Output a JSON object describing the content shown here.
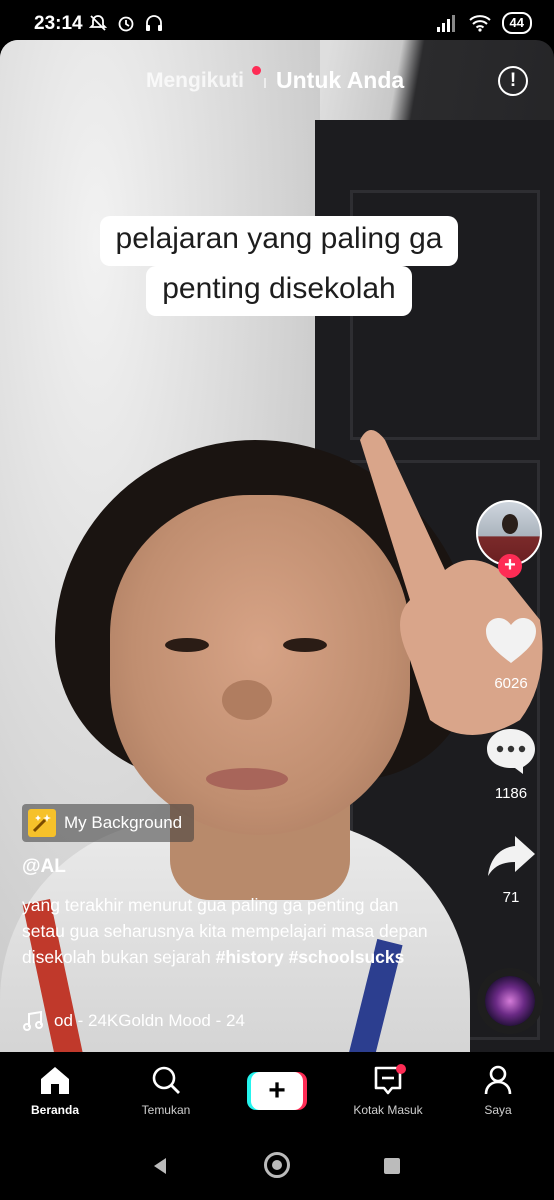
{
  "status_bar": {
    "time": "23:14",
    "battery": "44",
    "icons_left": [
      "mute-icon",
      "alarm-icon",
      "headset-icon"
    ],
    "icons_right": [
      "signal-icon",
      "wifi-icon",
      "battery-icon"
    ]
  },
  "top_tabs": {
    "following": "Mengikuti",
    "for_you": "Untuk Anda",
    "active": "for_you"
  },
  "caption": {
    "line1": "pelajaran yang paling ga",
    "line2": "penting disekolah"
  },
  "right_rail": {
    "likes": "6026",
    "comments": "1186",
    "shares": "71"
  },
  "effect": {
    "label": "My Background"
  },
  "post": {
    "username": "@AL",
    "description": "yang terakhir menurut gua paling ga penting dan setau gua seharusnya kita mempelajari masa depan disekolah bukan sejarah",
    "hashtag1": "#history",
    "hashtag2": "#schoolsucks",
    "music": "od - 24KGoldn    Mood - 24"
  },
  "bottom_nav": {
    "home": "Beranda",
    "discover": "Temukan",
    "inbox": "Kotak Masuk",
    "profile": "Saya"
  },
  "colors": {
    "accent_red": "#fe2c55",
    "accent_cyan": "#25f4ee",
    "background": "#000000"
  }
}
